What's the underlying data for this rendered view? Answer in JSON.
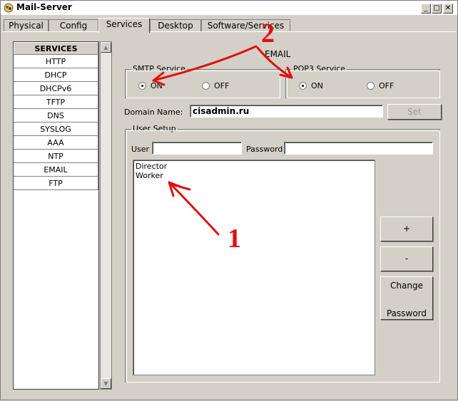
{
  "window": {
    "title": "Mail-Server"
  },
  "tabs": [
    {
      "label": "Physical",
      "active": false
    },
    {
      "label": "Config",
      "active": false
    },
    {
      "label": "Services",
      "active": true
    },
    {
      "label": "Desktop",
      "active": false
    },
    {
      "label": "Software/Services",
      "active": false
    }
  ],
  "sidebar": {
    "header": "SERVICES",
    "items": [
      "HTTP",
      "DHCP",
      "DHCPv6",
      "TFTP",
      "DNS",
      "SYSLOG",
      "AAA",
      "NTP",
      "EMAIL",
      "FTP"
    ]
  },
  "panel": {
    "title": "EMAIL",
    "smtp": {
      "label": "SMTP Service",
      "on_label": "ON",
      "off_label": "OFF",
      "selected": "ON"
    },
    "pop3": {
      "label": "POP3 Service",
      "on_label": "ON",
      "off_label": "OFF",
      "selected": "ON"
    },
    "domain": {
      "label": "Domain Name:",
      "value": "cisadmin.ru",
      "set_label": "Set"
    },
    "user_setup": {
      "label": "User Setup",
      "user_label": "User",
      "user_value": "",
      "password_label": "Password",
      "password_value": "",
      "users": [
        "Director",
        "Worker"
      ],
      "add_label": "+",
      "remove_label": "-",
      "change_password_line1": "Change",
      "change_password_line2": "Password"
    }
  },
  "annotations": {
    "one": "1",
    "two": "2"
  },
  "colors": {
    "annotation": "#e01010",
    "window_bg": "#d4d0c8"
  }
}
